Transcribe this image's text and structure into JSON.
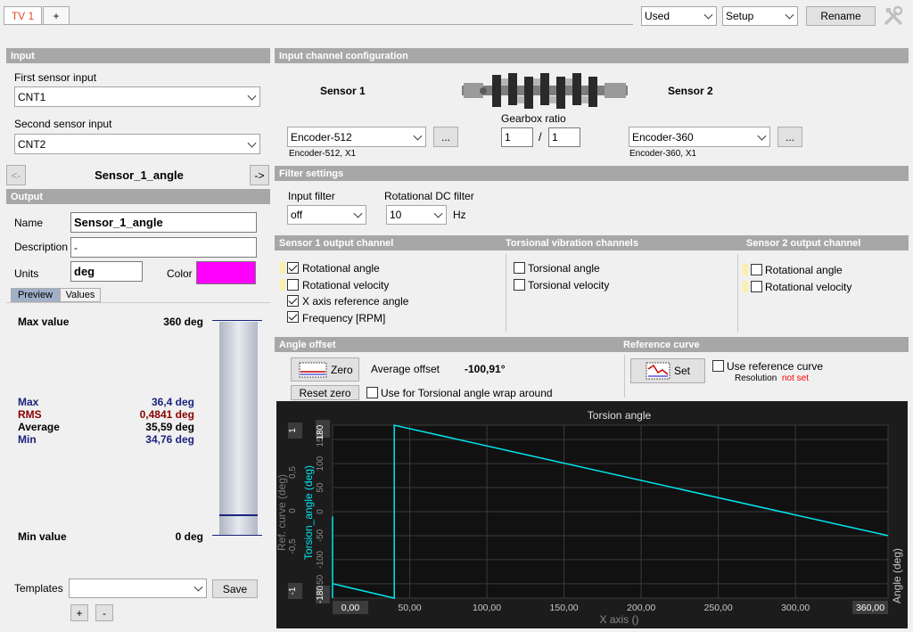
{
  "tabs": [
    {
      "label": "TV 1",
      "active": true
    },
    {
      "label": "+"
    }
  ],
  "top_bar": {
    "used_select": "Used",
    "setup_select": "Setup",
    "rename_label": "Rename"
  },
  "input": {
    "header": "Input",
    "first_sensor_label": "First sensor input",
    "first_sensor_value": "CNT1",
    "second_sensor_label": "Second sensor input",
    "second_sensor_value": "CNT2",
    "prev_label": "<-",
    "next_label": "->",
    "channel_name": "Sensor_1_angle"
  },
  "output": {
    "header": "Output",
    "name_label": "Name",
    "name_value": "Sensor_1_angle",
    "description_label": "Description",
    "description_value": "-",
    "units_label": "Units",
    "units_value": "deg",
    "color_label": "Color",
    "color_value": "#ff00ff",
    "tab_preview": "Preview",
    "tab_values": "Values",
    "max_value_label": "Max value",
    "max_value": "360 deg",
    "min_value_label": "Min value",
    "min_value": "0 deg",
    "stats": [
      {
        "label": "Max",
        "value": "36,4 deg",
        "color": "#1a237e"
      },
      {
        "label": "RMS",
        "value": "0,4841 deg",
        "color": "#8b0000"
      },
      {
        "label": "Average",
        "value": "35,59 deg",
        "color": "#000000"
      },
      {
        "label": "Min",
        "value": "34,76 deg",
        "color": "#1a237e"
      }
    ],
    "templates_label": "Templates",
    "templates_value": "",
    "save_label": "Save",
    "add_label": "+",
    "remove_label": "-"
  },
  "input_channel_config": {
    "header": "Input channel configuration",
    "sensor1_title": "Sensor 1",
    "sensor2_title": "Sensor 2",
    "gearbox_label": "Gearbox ratio",
    "gear_num": "1",
    "gear_den": "1",
    "gear_sep": "/",
    "sensor1_encoder": "Encoder-512",
    "sensor1_desc": "Encoder-512, X1",
    "sensor2_encoder": "Encoder-360",
    "sensor2_desc": "Encoder-360, X1",
    "more_label": "..."
  },
  "filter_settings": {
    "header": "Filter settings",
    "input_filter_label": "Input filter",
    "input_filter_value": "off",
    "dc_filter_label": "Rotational DC filter",
    "dc_filter_value": "10",
    "dc_filter_unit": "Hz"
  },
  "sensor1_output": {
    "header": "Sensor 1 output channel",
    "items": [
      {
        "label": "Rotational angle",
        "checked": true,
        "marker": true
      },
      {
        "label": "Rotational velocity",
        "checked": false,
        "marker": true
      },
      {
        "label": "X axis reference angle",
        "checked": true,
        "marker": false
      },
      {
        "label": "Frequency [RPM]",
        "checked": true,
        "marker": false
      }
    ]
  },
  "torsional_channels": {
    "header": "Torsional vibration channels",
    "items": [
      {
        "label": "Torsional angle",
        "checked": false
      },
      {
        "label": "Torsional velocity",
        "checked": false
      }
    ]
  },
  "sensor2_output": {
    "header": "Sensor 2 output channel",
    "items": [
      {
        "label": "Rotational angle",
        "checked": false
      },
      {
        "label": "Rotational velocity",
        "checked": false
      }
    ]
  },
  "angle_offset": {
    "header": "Angle offset",
    "zero_label": "Zero",
    "average_offset_label": "Average offset",
    "average_offset_value": "-100,91°",
    "reset_zero_label": "Reset zero",
    "wrap_label": "Use for Torsional angle wrap around"
  },
  "reference_curve": {
    "header": "Reference curve",
    "set_label": "Set",
    "use_label": "Use reference curve",
    "resolution_label": "Resolution",
    "resolution_value": "not set",
    "resolution_color": "#ff0000"
  },
  "chart_data": {
    "type": "line",
    "title": "Torsion angle",
    "xlabel": "X axis ()",
    "ylabel": "Torsion_angle (deg)",
    "ylabel_secondary": "Ref. curve (deg)",
    "ylabel_right": "Angle (deg)",
    "xlim": [
      0,
      360
    ],
    "ylim": [
      -180,
      180
    ],
    "x_ticks": [
      "0,00",
      "50,00",
      "100,00",
      "150,00",
      "200,00",
      "250,00",
      "300,00",
      "360,00"
    ],
    "x_tick_values": [
      0,
      50,
      100,
      150,
      200,
      250,
      300,
      360
    ],
    "y_ticks": [
      "-180",
      "-150",
      "-100",
      "-50",
      "0",
      "50",
      "100",
      "150",
      "180"
    ],
    "y_tick_values": [
      -180,
      -150,
      -100,
      -50,
      0,
      50,
      100,
      150,
      180
    ],
    "ref_ticks": [
      "-1",
      "-0,5",
      "0",
      "0,5",
      "1"
    ],
    "ref_tick_values": [
      -1,
      -0.5,
      0,
      0.5,
      1
    ],
    "grid": true,
    "series": [
      {
        "color": "#00e5ee",
        "x": [
          0,
          0,
          0,
          40,
          40,
          360
        ],
        "y": [
          -10,
          -180,
          -150,
          -180,
          180,
          -50
        ]
      }
    ]
  }
}
